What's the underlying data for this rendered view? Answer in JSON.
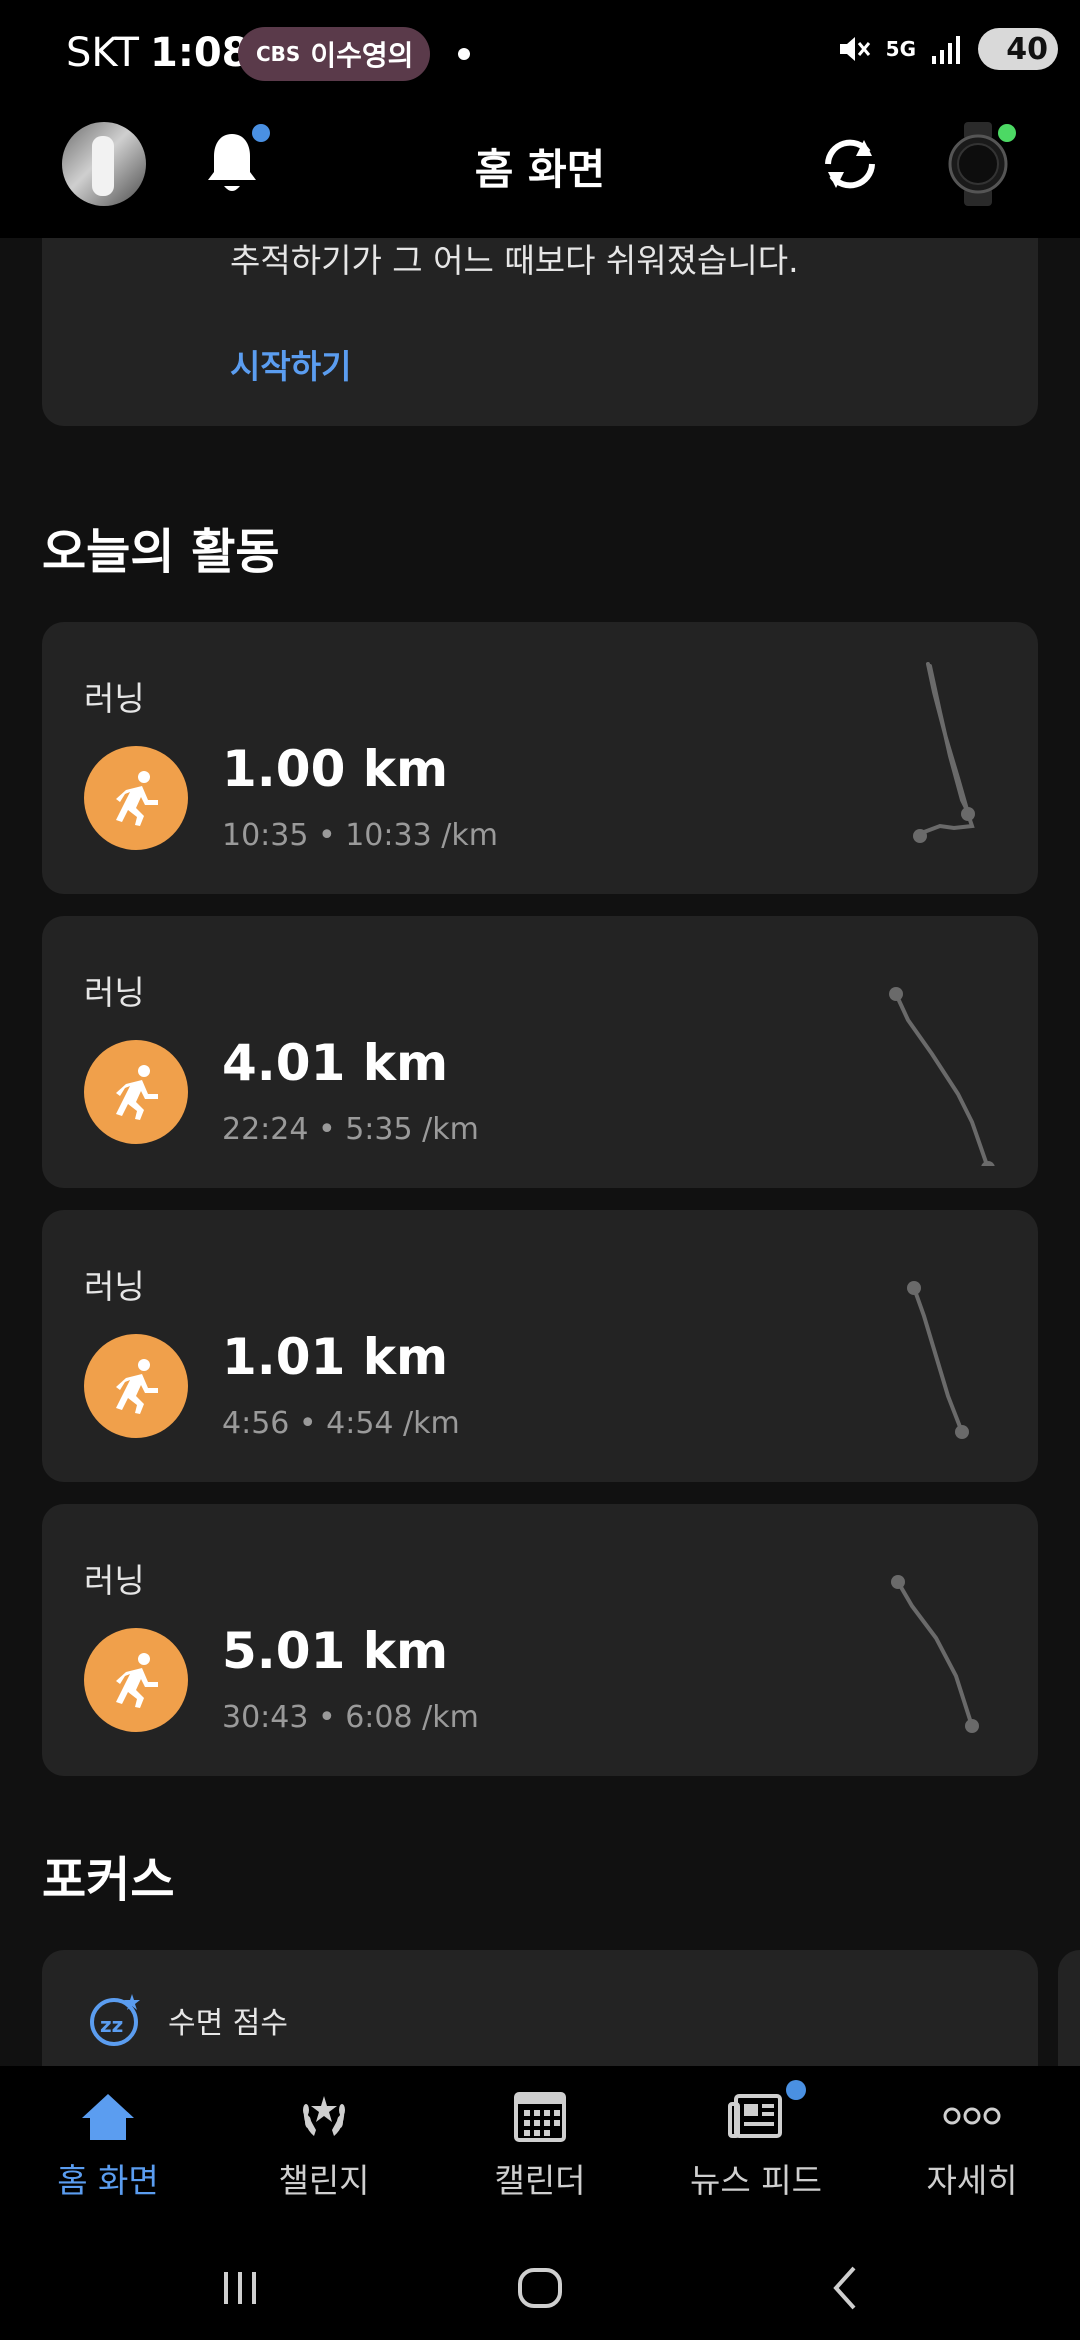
{
  "status_bar": {
    "carrier": "SKT",
    "time": "1:08",
    "pill_logo": "CBS",
    "pill_text": "이수영의",
    "network": "5G",
    "battery": "40"
  },
  "app_bar": {
    "title": "홈 화면"
  },
  "promo": {
    "text": "추적하기가 그 어느 때보다 쉬워졌습니다.",
    "link": "시작하기"
  },
  "today": {
    "title": "오늘의 활동",
    "activities": [
      {
        "label": "러닝",
        "distance": "1.00 km",
        "detail": "10:35 • 10:33 /km"
      },
      {
        "label": "러닝",
        "distance": "4.01 km",
        "detail": "22:24 • 5:35 /km"
      },
      {
        "label": "러닝",
        "distance": "1.01 km",
        "detail": "4:56 • 4:54 /km"
      },
      {
        "label": "러닝",
        "distance": "5.01 km",
        "detail": "30:43 • 6:08 /km"
      }
    ]
  },
  "focus": {
    "title": "포커스",
    "card_label": "수면 점수"
  },
  "bottom_nav": {
    "items": [
      {
        "label": "홈 화면",
        "icon": "home-icon"
      },
      {
        "label": "챌린지",
        "icon": "laurel-icon"
      },
      {
        "label": "캘린더",
        "icon": "calendar-icon"
      },
      {
        "label": "뉴스 피드",
        "icon": "newsfeed-icon"
      },
      {
        "label": "자세히",
        "icon": "more-icon"
      }
    ]
  },
  "colors": {
    "accent": "#5b9df0",
    "activity": "#f0a04b",
    "card": "#232323",
    "background": "#111111"
  }
}
